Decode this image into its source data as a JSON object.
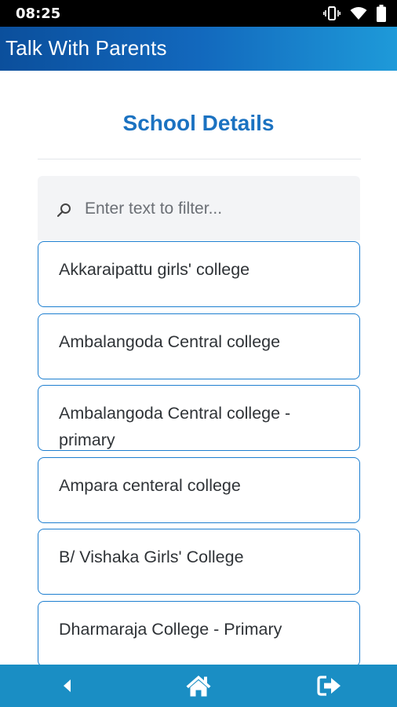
{
  "status_bar": {
    "time": "08:25",
    "icons": [
      "vibrate-icon",
      "wifi-icon",
      "battery-icon"
    ]
  },
  "app_bar": {
    "title": "Talk With Parents",
    "gradient": [
      "#0b4f9c",
      "#1e9ad9"
    ]
  },
  "page": {
    "title": "School Details",
    "title_color": "#1b72c1"
  },
  "search": {
    "placeholder": "Enter text to filter...",
    "value": ""
  },
  "schools": [
    "Akkaraipattu girls' college",
    "Ambalangoda Central college",
    "Ambalangoda Central college - primary",
    "Ampara centeral college",
    "B/ Vishaka Girls' College",
    "Dharmaraja College - Primary"
  ],
  "bottom_nav": {
    "background": "#1a8ec4",
    "items": [
      "back-icon",
      "home-icon",
      "logout-icon"
    ]
  }
}
